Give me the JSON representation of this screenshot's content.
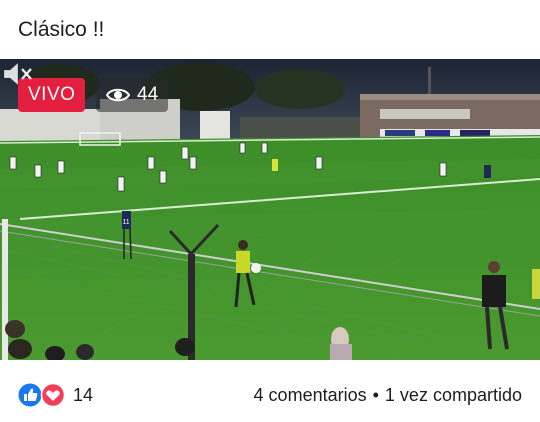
{
  "post": {
    "title": "Clásico !!"
  },
  "video": {
    "live_label": "VIVO",
    "viewer_count": "44",
    "icons": {
      "viewers": "eye-icon",
      "mute": "speaker-muted-icon"
    },
    "colors": {
      "live": "#e41e3f",
      "pitch": "#3f8f2a"
    },
    "player_numbers": [
      "11"
    ]
  },
  "footer": {
    "reaction_icons": [
      "like-icon",
      "love-icon"
    ],
    "reaction_count": "14",
    "comments_label": "4 comentarios",
    "separator": "•",
    "shares_label": "1 vez compartido"
  }
}
